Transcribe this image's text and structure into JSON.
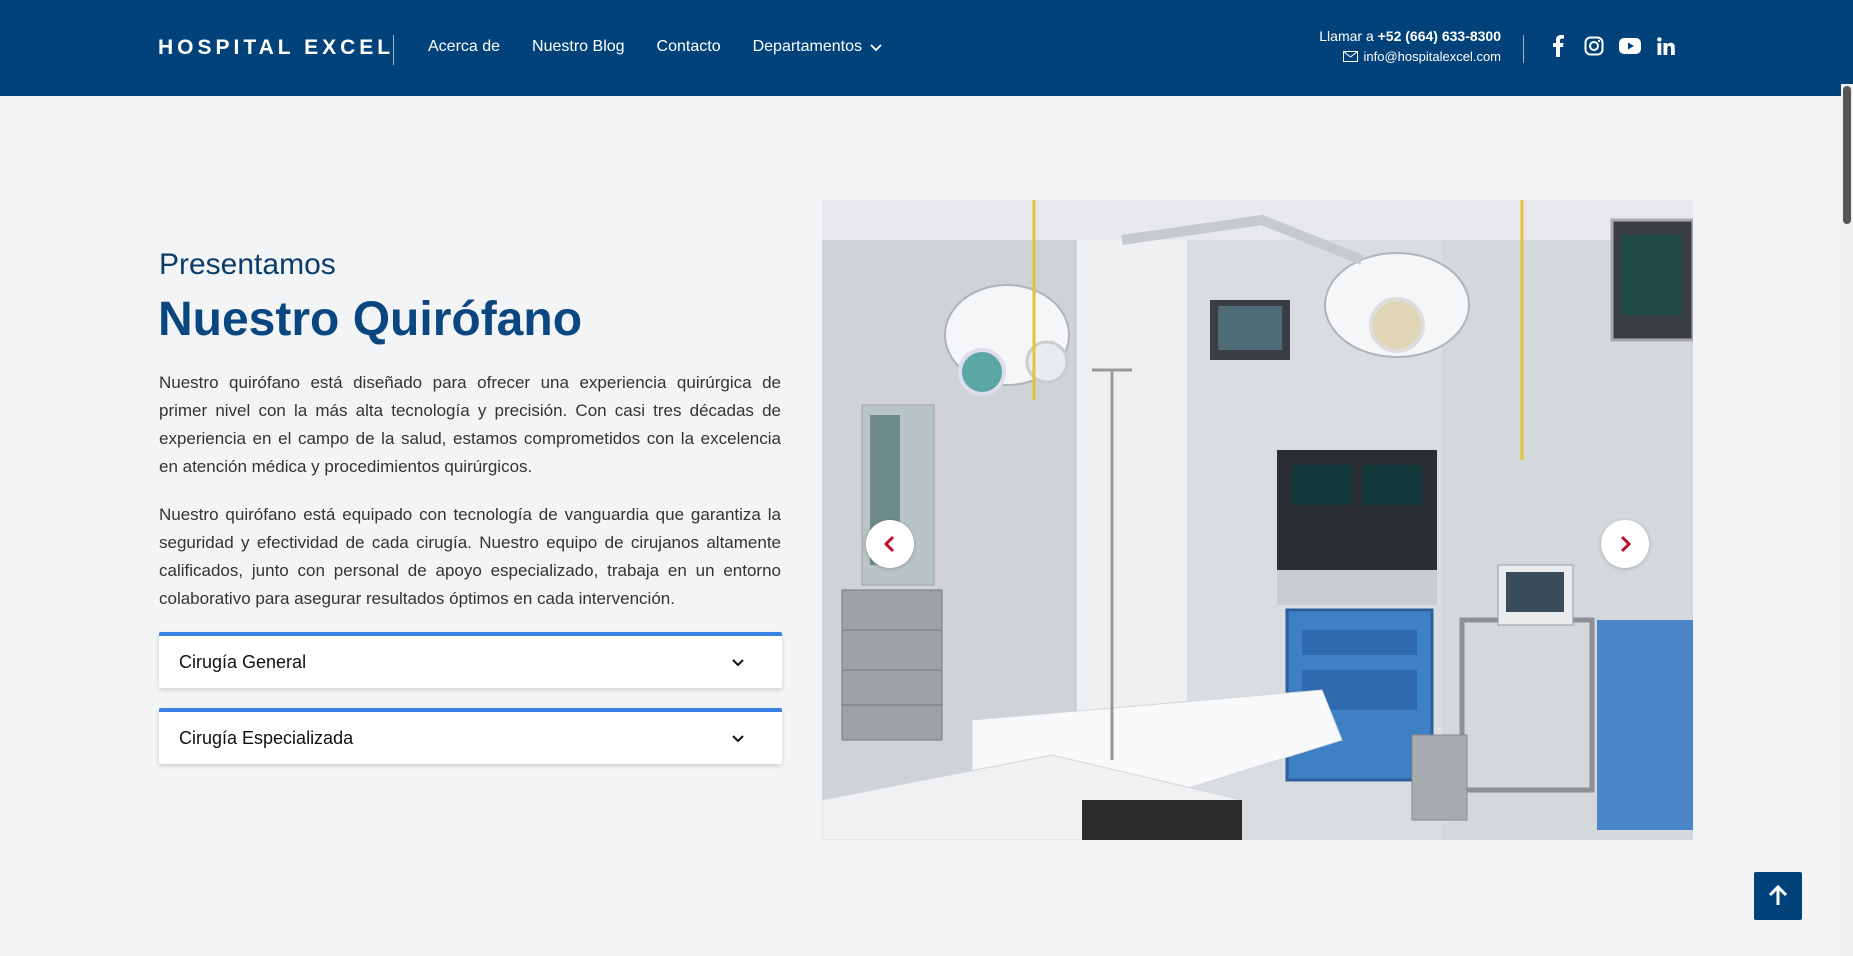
{
  "header": {
    "brand": "HOSPITAL EXCEL",
    "nav": [
      {
        "label": "Acerca de"
      },
      {
        "label": "Nuestro Blog"
      },
      {
        "label": "Contacto"
      },
      {
        "label": "Departamentos",
        "has_dropdown": true
      }
    ],
    "contact": {
      "call_prefix": "Llamar a",
      "phone": "+52 (664) 633-8300",
      "email": "info@hospitalexcel.com"
    },
    "socials": [
      "facebook-icon",
      "instagram-icon",
      "youtube-icon",
      "linkedin-icon"
    ]
  },
  "main": {
    "intro": "Presentamos",
    "title": "Nuestro Quirófano",
    "paragraphs": [
      "Nuestro quirófano está diseñado para ofrecer una experiencia quirúrgica de primer nivel con la más alta tecnología y precisión. Con casi tres décadas de experiencia en el campo de la salud, estamos comprometidos con la excelencia en atención médica y procedimientos quirúrgicos.",
      "Nuestro quirófano está equipado con tecnología de vanguardia que garantiza la seguridad y efectividad de cada cirugía. Nuestro equipo de cirujanos altamente calificados, junto con personal de apoyo especializado, trabaja en un entorno colaborativo para asegurar resultados óptimos en cada intervención."
    ],
    "accordion": [
      {
        "label": "Cirugía General"
      },
      {
        "label": "Cirugía Especializada"
      }
    ]
  },
  "carousel": {
    "image": "operating-room-photo",
    "prev_icon": "chevron-left-icon",
    "next_icon": "chevron-right-icon"
  },
  "colors": {
    "primary": "#02427a",
    "title": "#0a4780",
    "accent_border": "#3b82e6",
    "arrow": "#c0102b",
    "background": "#f3f4f6"
  }
}
